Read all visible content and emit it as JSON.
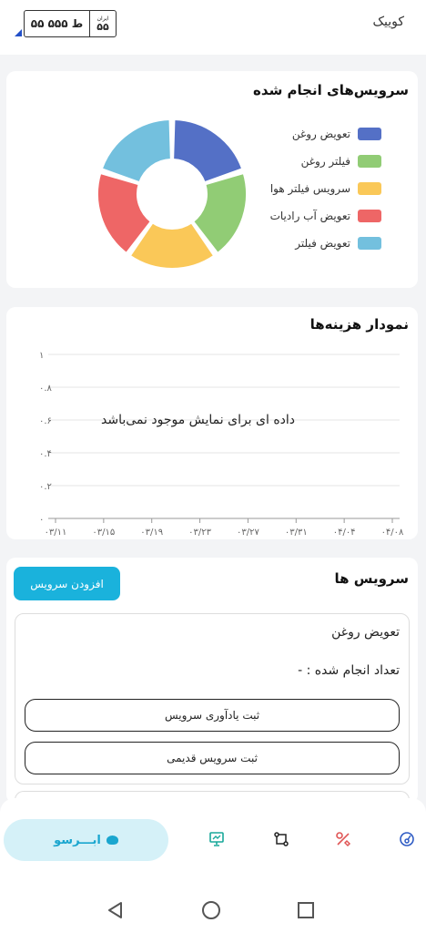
{
  "header": {
    "car_name": "کوییک",
    "plate": {
      "main": "۵۵ ط ۵۵۵",
      "iran_label": "ایران",
      "code": "۵۵"
    }
  },
  "services_chart": {
    "title": "سرویس‌های انجام شده"
  },
  "cost_chart": {
    "title": "نمودار هزینه‌ها",
    "no_data_text": "داده ای برای نمایش موجود نمی‌باشد"
  },
  "services": {
    "title": "سرویس ها",
    "add_label": "افزودن سرویس",
    "items": [
      {
        "name": "تعویض روغن",
        "count_label": "تعداد انجام شده : -",
        "reminder_label": "ثبت یادآوری سرویس",
        "old_service_label": "ثبت سرویس قدیمی"
      }
    ]
  },
  "bottom_nav": {
    "brand_label": "ابـــرسو",
    "icons": [
      "presentation-icon",
      "route-icon",
      "tools-icon",
      "gauge-icon"
    ]
  },
  "system_nav": {
    "icons": [
      "back-icon",
      "home-icon",
      "recents-icon"
    ]
  },
  "chart_data": [
    {
      "type": "pie",
      "variant": "donut",
      "title": "سرویس‌های انجام شده",
      "categories": [
        "تعویض روغن",
        "فیلتر روغن",
        "سرویس فیلتر هوا",
        "تعویض آب رادیات",
        "تعویض فیلتر"
      ],
      "colors": [
        "#5470c6",
        "#91cc75",
        "#fac858",
        "#ee6666",
        "#73c0de"
      ],
      "values": [
        1,
        1,
        1,
        1,
        1
      ],
      "legend_position": "right"
    },
    {
      "type": "line",
      "title": "نمودار هزینه‌ها",
      "x": [
        "۰۳/۱۱",
        "۰۳/۱۵",
        "۰۳/۱۹",
        "۰۳/۲۳",
        "۰۳/۲۷",
        "۰۳/۳۱",
        "۰۴/۰۴",
        "۰۴/۰۸"
      ],
      "y_ticks": [
        "۰",
        "۰.۲",
        "۰.۴",
        "۰.۶",
        "۰.۸",
        "۱"
      ],
      "ylim": [
        0,
        1
      ],
      "series": [],
      "grid": true
    }
  ]
}
